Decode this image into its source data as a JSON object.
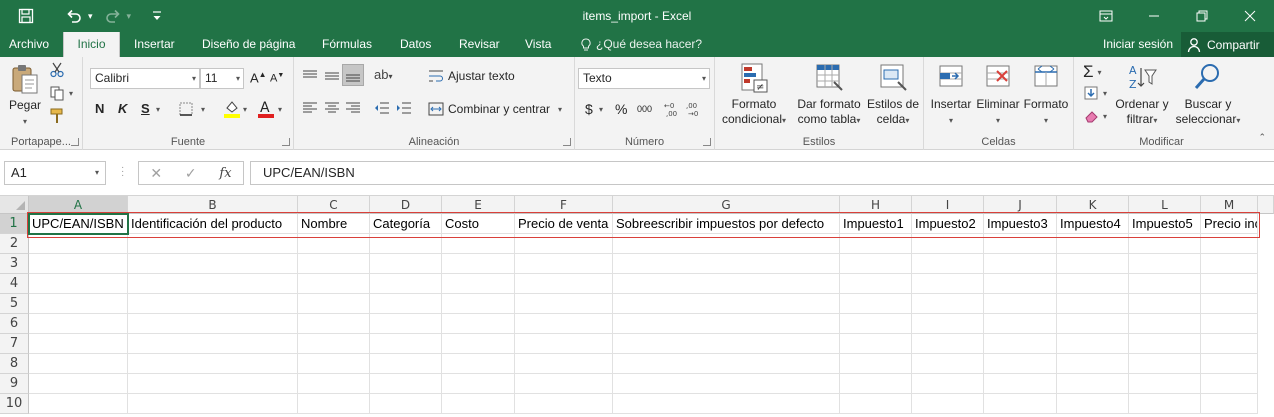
{
  "window": {
    "title": "items_import - Excel"
  },
  "tabs": [
    {
      "label": "Archivo",
      "active": false
    },
    {
      "label": "Inicio",
      "active": true
    },
    {
      "label": "Insertar",
      "active": false
    },
    {
      "label": "Diseño de página",
      "active": false
    },
    {
      "label": "Fórmulas",
      "active": false
    },
    {
      "label": "Datos",
      "active": false
    },
    {
      "label": "Revisar",
      "active": false
    },
    {
      "label": "Vista",
      "active": false
    }
  ],
  "tell_me": "¿Qué desea hacer?",
  "signin": "Iniciar sesión",
  "share": "Compartir",
  "ribbon": {
    "clipboard": {
      "label": "Portapape...",
      "paste": "Pegar"
    },
    "font": {
      "label": "Fuente",
      "name": "Calibri",
      "size": "11",
      "bold": "N",
      "italic": "K",
      "underline": "S"
    },
    "alignment": {
      "label": "Alineación",
      "wrap": "Ajustar texto",
      "merge": "Combinar y centrar"
    },
    "number": {
      "label": "Número",
      "format": "Texto",
      "currency": "$",
      "percent": "%",
      "thousands": "000"
    },
    "styles": {
      "label": "Estilos",
      "conditional_1": "Formato",
      "conditional_2": "condicional",
      "table_1": "Dar formato",
      "table_2": "como tabla",
      "cell_1": "Estilos de",
      "cell_2": "celda"
    },
    "cells": {
      "label": "Celdas",
      "insert": "Insertar",
      "delete": "Eliminar",
      "format": "Formato"
    },
    "editing": {
      "label": "Modificar",
      "sort_1": "Ordenar y",
      "sort_2": "filtrar",
      "find_1": "Buscar y",
      "find_2": "seleccionar"
    }
  },
  "formula_bar": {
    "name_box": "A1",
    "fx": "fx",
    "content": "UPC/EAN/ISBN"
  },
  "sheet": {
    "columns": [
      "A",
      "B",
      "C",
      "D",
      "E",
      "F",
      "G",
      "H",
      "I",
      "J",
      "K",
      "L",
      "M"
    ],
    "rows": [
      "1",
      "2",
      "3",
      "4",
      "5",
      "6",
      "7",
      "8",
      "9",
      "10"
    ],
    "row1": [
      "UPC/EAN/ISBN",
      "Identificación del producto",
      "Nombre",
      "Categoría",
      "Costo",
      "Precio de venta",
      "Sobreescribir impuestos por defecto",
      "Impuesto1",
      "Impuesto2",
      "Impuesto3",
      "Impuesto4",
      "Impuesto5",
      "Precio inc"
    ],
    "active_cell": "A1"
  },
  "colors": {
    "excel_green": "#217346",
    "highlight_red": "#d9403a"
  }
}
